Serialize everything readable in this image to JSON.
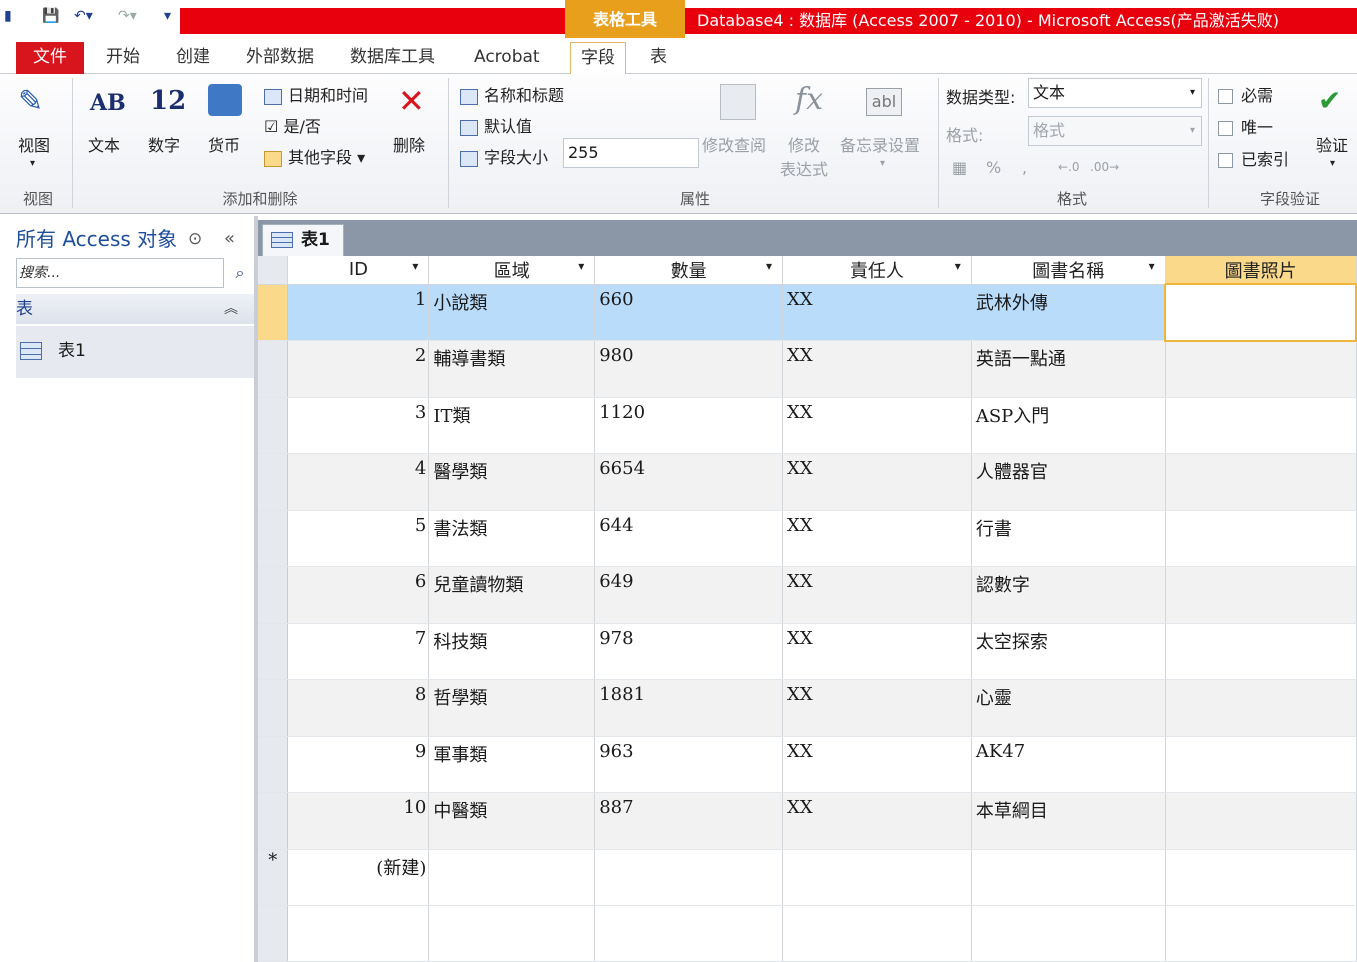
{
  "title_bar": {
    "context_tools": "表格工具",
    "title": "Database4 : 数据库 (Access 2007 - 2010)  -  Microsoft Access(产品激活失败)"
  },
  "tabs": [
    "文件",
    "开始",
    "创建",
    "外部数据",
    "数据库工具",
    "Acrobat",
    "字段",
    "表"
  ],
  "ribbon": {
    "view": {
      "label": "视图",
      "group": "视图"
    },
    "add_delete": {
      "text": "文本",
      "number": "数字",
      "currency": "货币",
      "datetime": "日期和时间",
      "yesno": "是/否",
      "more_fields": "其他字段",
      "delete": "删除",
      "group": "添加和删除",
      "icon_text": "AB",
      "icon_number": "12"
    },
    "properties": {
      "name_caption": "名称和标题",
      "default_value": "默认值",
      "field_size_label": "字段大小",
      "field_size_value": "255",
      "modify_lookups": "修改查阅",
      "modify_expression_1": "修改",
      "modify_expression_2": "表达式",
      "memo_settings": "备忘录设置",
      "group": "属性"
    },
    "formatting": {
      "data_type_label": "数据类型:",
      "data_type_value": "文本",
      "format_label": "格式:",
      "format_value": "格式",
      "percent": "%",
      "comma": ",",
      "group": "格式"
    },
    "validation": {
      "required": "必需",
      "unique": "唯一",
      "indexed": "已索引",
      "validation": "验证",
      "group": "字段验证"
    }
  },
  "nav": {
    "header": "所有 Access 对象",
    "search_placeholder": "搜索...",
    "section": "表",
    "items": [
      {
        "label": "表1"
      }
    ]
  },
  "doc_tab": "表1",
  "table": {
    "columns": [
      "ID",
      "區域",
      "數量",
      "責任人",
      "圖書名稱",
      "圖書照片"
    ],
    "rows": [
      {
        "id": "1",
        "region": "小說類",
        "qty": "660",
        "owner": "XX",
        "title": "武林外傳"
      },
      {
        "id": "2",
        "region": "輔導書類",
        "qty": "980",
        "owner": "XX",
        "title": "英語一點通"
      },
      {
        "id": "3",
        "region": "IT類",
        "qty": "1120",
        "owner": "XX",
        "title": "ASP入門"
      },
      {
        "id": "4",
        "region": "醫學類",
        "qty": "6654",
        "owner": "XX",
        "title": "人體器官"
      },
      {
        "id": "5",
        "region": "書法類",
        "qty": "644",
        "owner": "XX",
        "title": "行書"
      },
      {
        "id": "6",
        "region": "兒童讀物類",
        "qty": "649",
        "owner": "XX",
        "title": "認數字"
      },
      {
        "id": "7",
        "region": "科技類",
        "qty": "978",
        "owner": "XX",
        "title": "太空探索"
      },
      {
        "id": "8",
        "region": "哲學類",
        "qty": "1881",
        "owner": "XX",
        "title": "心靈"
      },
      {
        "id": "9",
        "region": "軍事類",
        "qty": "963",
        "owner": "XX",
        "title": "AK47"
      },
      {
        "id": "10",
        "region": "中醫類",
        "qty": "887",
        "owner": "XX",
        "title": "本草綱目"
      }
    ],
    "new_row_marker": "*",
    "new_row_label": "(新建)"
  },
  "colors": {
    "file_tab": "#d8141c",
    "title_red": "#e8000d",
    "context_orange": "#e8a01c",
    "selected_row": "#b9dcfb"
  }
}
